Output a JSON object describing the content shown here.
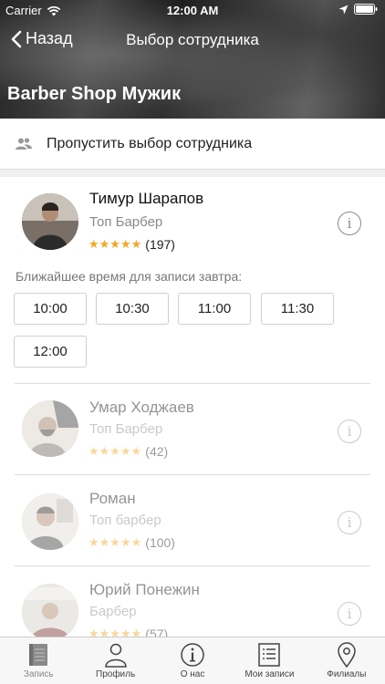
{
  "status_bar": {
    "carrier": "Carrier",
    "time": "12:00 AM"
  },
  "nav": {
    "back_label": "Назад",
    "title": "Выбор сотрудника"
  },
  "shop": {
    "name": "Barber Shop Мужик"
  },
  "skip": {
    "label": "Пропустить выбор сотрудника"
  },
  "employees": [
    {
      "name": "Тимур Шарапов",
      "role": "Топ Барбер",
      "stars": "★★★★★",
      "reviews": "(197)",
      "rating": 5,
      "available": true
    },
    {
      "name": "Умар Ходжаев",
      "role": "Топ Барбер",
      "stars": "★★★★★",
      "reviews": "(42)",
      "rating": 5,
      "available": false
    },
    {
      "name": "Роман",
      "role": "Топ барбер",
      "stars": "★★★★★",
      "reviews": "(100)",
      "rating": 5,
      "available": false
    },
    {
      "name": "Юрий Понежин",
      "role": "Барбер",
      "stars": "★★★★★",
      "reviews": "(57)",
      "rating": 5,
      "available": false
    }
  ],
  "slots": {
    "label": "Ближайшее время для записи завтра:",
    "times": [
      "10:00",
      "10:30",
      "11:00",
      "11:30",
      "12:00"
    ]
  },
  "tabs": [
    {
      "label": "Запись",
      "icon": "book-icon",
      "active": true
    },
    {
      "label": "Профиль",
      "icon": "person-icon",
      "active": false
    },
    {
      "label": "О нас",
      "icon": "info-icon",
      "active": false
    },
    {
      "label": "Мои записи",
      "icon": "list-icon",
      "active": false
    },
    {
      "label": "Филиалы",
      "icon": "map-pin-icon",
      "active": false
    }
  ],
  "colors": {
    "star": "#f5a623",
    "accent_text": "#222222",
    "muted_text": "#8a8a8a"
  }
}
